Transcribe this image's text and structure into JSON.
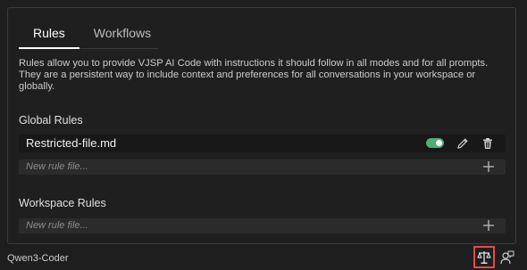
{
  "tabs": [
    {
      "label": "Rules",
      "active": true
    },
    {
      "label": "Workflows",
      "active": false
    }
  ],
  "description": "Rules allow you to provide VJSP AI Code with instructions it should follow in all modes and for all prompts. They are a persistent way to include context and preferences for all conversations in your workspace or globally.",
  "global_rules": {
    "title": "Global Rules",
    "items": [
      {
        "name": "Restricted-file.md",
        "enabled": true
      }
    ],
    "new_placeholder": "New rule file..."
  },
  "workspace_rules": {
    "title": "Workspace Rules",
    "new_placeholder": "New rule file..."
  },
  "footer": {
    "model": "Qwen3-Coder",
    "scale_icon": "scale-icon",
    "person_icon": "person-feedback-icon"
  },
  "colors": {
    "toggle_on": "#4caf7a",
    "highlight_border": "#e84a4a"
  }
}
